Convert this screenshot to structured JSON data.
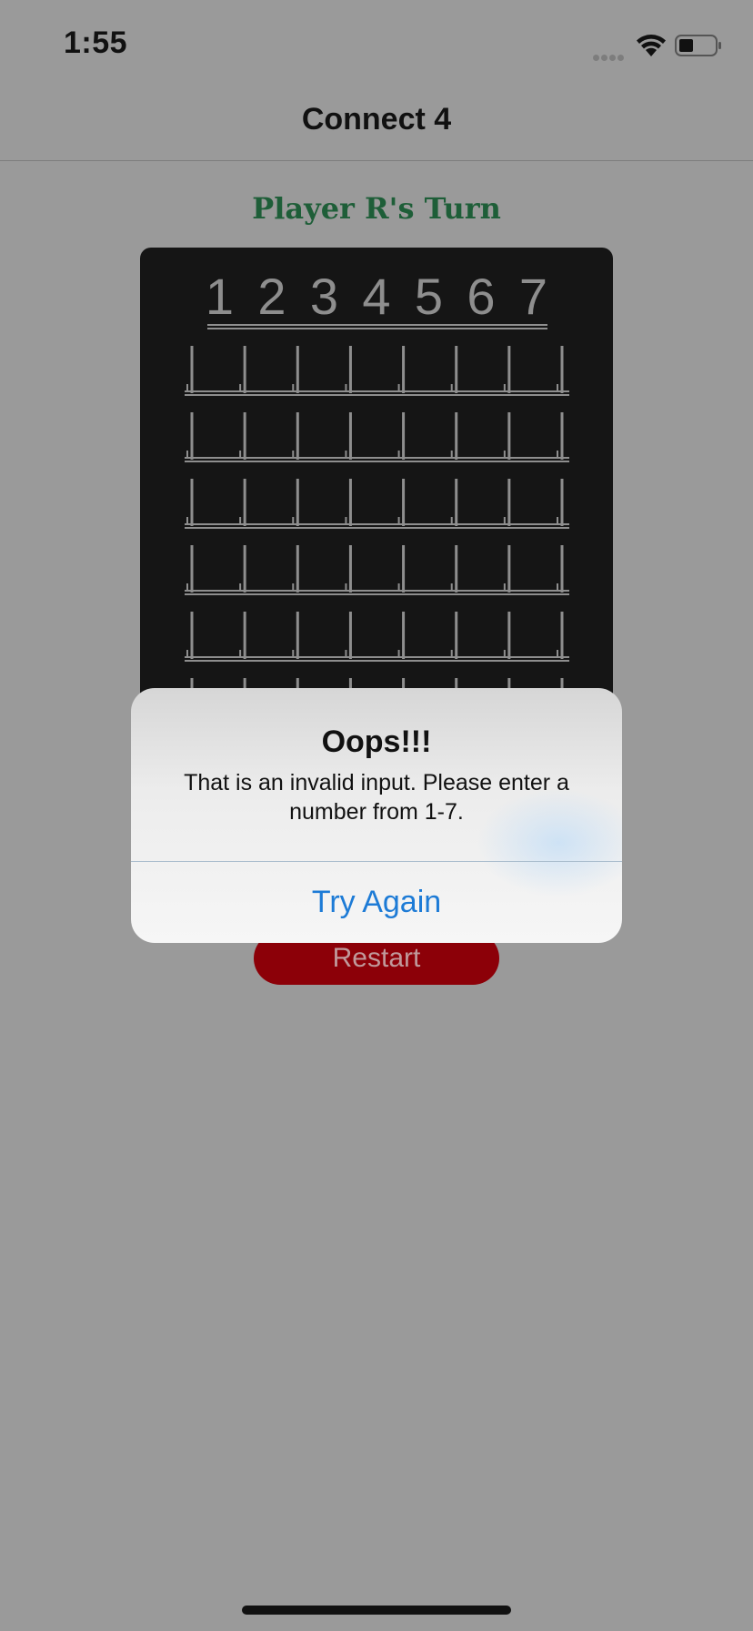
{
  "status_bar": {
    "time": "1:55",
    "icons": [
      "cellular-dots-icon",
      "wifi-icon",
      "battery-icon"
    ]
  },
  "nav": {
    "title": "Connect 4"
  },
  "game": {
    "turn_label": "Player R's Turn",
    "turn_color": "#1e5e38",
    "column_numbers": [
      "1",
      "2",
      "3",
      "4",
      "5",
      "6",
      "7"
    ],
    "rows": 6,
    "columns": 7
  },
  "restart_button": {
    "label": "Restart",
    "color": "#8c0008"
  },
  "alert": {
    "title": "Oops!!!",
    "message": "That is an invalid input. Please enter a number from 1-7.",
    "button_label": "Try Again",
    "button_color": "#1d7bd6"
  }
}
